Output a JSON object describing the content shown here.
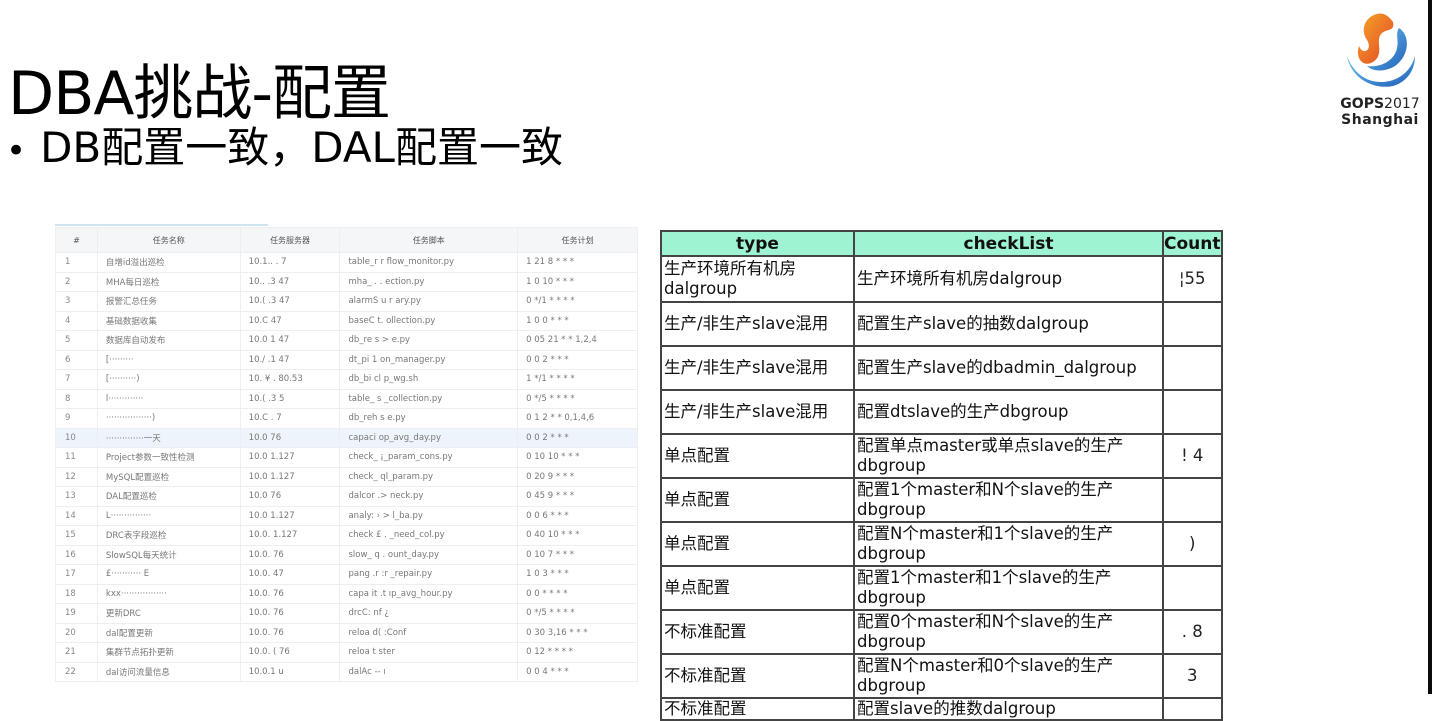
{
  "slide": {
    "title": "DBA挑战-配置",
    "bullet": "DB配置一致，DAL配置一致",
    "bullet_symbol": "•"
  },
  "logo": {
    "icon": "gops-flame-logo-icon",
    "brand": "GOPS",
    "year": "2017",
    "city": "Shanghai",
    "colors": {
      "orange": "#f08a24",
      "red": "#e2452b",
      "blue": "#2c7fd1",
      "light_blue": "#6cc3f0"
    }
  },
  "task_table": {
    "headers": [
      "#",
      "任务名称",
      "任务服务器",
      "任务脚本",
      "任务计划"
    ],
    "highlighted_row": 10,
    "rows": [
      {
        "num": "1",
        "name": "自增id溢出巡检",
        "server": "10.1.. . 7",
        "script": "table_r r flow_monitor.py",
        "schedule": "1 21 8 * * *"
      },
      {
        "num": "2",
        "name": "MHA每日巡检",
        "server": "10.. .3  47",
        "script": "mha_ . . ection.py",
        "schedule": "1 0 10 * * *"
      },
      {
        "num": "3",
        "name": "报警汇总任务",
        "server": "10.( .3  47",
        "script": "alarmS u r ary.py",
        "schedule": "0 */1 * * * *"
      },
      {
        "num": "4",
        "name": "基础数据收集",
        "server": "10.C    47",
        "script": "baseC t. ollection.py",
        "schedule": "1 0 0 * * *"
      },
      {
        "num": "5",
        "name": "数据库自动发布",
        "server": "10.0 1  47",
        "script": "db_re s > e.py",
        "schedule": "0 05 21 * * 1,2,4"
      },
      {
        "num": "6",
        "name": "[·········",
        "server": "10./ .1  47",
        "script": "dt_pi 1  on_manager.py",
        "schedule": "0 0 2 * * *"
      },
      {
        "num": "7",
        "name": "[··········)",
        "server": "10. ¥ .  80.53",
        "script": "db_bi cl  p_wg.sh",
        "schedule": "1 */1 * * * *"
      },
      {
        "num": "8",
        "name": "l·············",
        "server": "10.(   .3 5",
        "script": "table_ s  _collection.py",
        "schedule": "0 */5 * * * *"
      },
      {
        "num": "9",
        "name": "·················)",
        "server": "10.C   . 7",
        "script": "db_reh s  e.py",
        "schedule": "0 1 2 * * 0,1,4,6"
      },
      {
        "num": "10",
        "name": "··············一天",
        "server": "10.0   76",
        "script": "capaci    op_avg_day.py",
        "schedule": "0 0 2 * * *"
      },
      {
        "num": "11",
        "name": "Project参数一致性检测",
        "server": "10.0   1.127",
        "script": "check_   ¡_param_cons.py",
        "schedule": "0 10 10 * * *"
      },
      {
        "num": "12",
        "name": "MySQL配置巡检",
        "server": "10.0   1.127",
        "script": "check_    ql_param.py",
        "schedule": "0 20 9 * * *"
      },
      {
        "num": "13",
        "name": "DAL配置巡检",
        "server": "10.0   76",
        "script": "dalcor  .> neck.py",
        "schedule": "0 45 9 * * *"
      },
      {
        "num": "14",
        "name": "L···············",
        "server": "10.0   1.127",
        "script": "analy: › > l_ba.py",
        "schedule": "0 0 6 * * *"
      },
      {
        "num": "15",
        "name": "DRC表字段巡检",
        "server": "10.0.   1.127",
        "script": "check £ . _need_col.py",
        "schedule": "0 40 10 * * *"
      },
      {
        "num": "16",
        "name": "SlowSQL每天统计",
        "server": "10.0.   76",
        "script": "slow_ q . ount_day.py",
        "schedule": "0 10 7 * * *"
      },
      {
        "num": "17",
        "name": "£··········· E",
        "server": "10.0.   47",
        "script": "pang  .r :r _repair.py",
        "schedule": "1 0 3 * * *"
      },
      {
        "num": "18",
        "name": "kxx·················",
        "server": "10.0.   76",
        "script": "capa it  .t  ıp_avg_hour.py",
        "schedule": "0 0 * * * *"
      },
      {
        "num": "19",
        "name": "更新DRC",
        "server": "10.0.   76",
        "script": "drcC: nf ¿",
        "schedule": "0 */5 * * * *"
      },
      {
        "num": "20",
        "name": "dal配置更新",
        "server": "10.0.   76",
        "script": "reloa d(  :Conf",
        "schedule": "0 30 3,16 * * *"
      },
      {
        "num": "21",
        "name": "集群节点拓扑更新",
        "server": "10.0. ( 76",
        "script": "reloa t   ster",
        "schedule": "0 12 * * * *"
      },
      {
        "num": "22",
        "name": "dal访问流量信息",
        "server": "10.0.1   u",
        "script": "dalAc  -- ı",
        "schedule": "0 0 4 * * *"
      }
    ]
  },
  "check_table": {
    "header_color": "#9ef3d3",
    "headers": {
      "type": "type",
      "checklist": "checkList",
      "count": "Count"
    },
    "rows": [
      {
        "type": "生产环境所有机房dalgroup",
        "checklist": "生产环境所有机房dalgroup",
        "count": "¦55"
      },
      {
        "type": "生产/非生产slave混用",
        "checklist": "配置生产slave的抽数dalgroup",
        "count": ""
      },
      {
        "type": "生产/非生产slave混用",
        "checklist": "配置生产slave的dbadmin_dalgroup",
        "count": ""
      },
      {
        "type": "生产/非生产slave混用",
        "checklist": "配置dtslave的生产dbgroup",
        "count": ""
      },
      {
        "type": "单点配置",
        "checklist": "配置单点master或单点slave的生产dbgroup",
        "count": "! 4"
      },
      {
        "type": "单点配置",
        "checklist": "配置1个master和N个slave的生产dbgroup",
        "count": ""
      },
      {
        "type": "单点配置",
        "checklist": "配置N个master和1个slave的生产dbgroup",
        "count": ")"
      },
      {
        "type": "单点配置",
        "checklist": "配置1个master和1个slave的生产dbgroup",
        "count": ""
      },
      {
        "type": "不标准配置",
        "checklist": "配置0个master和N个slave的生产dbgroup",
        "count": ". 8"
      },
      {
        "type": "不标准配置",
        "checklist": "配置N个master和0个slave的生产dbgroup",
        "count": "3"
      },
      {
        "type": "不标准配置",
        "checklist": "配置slave的推数dalgroup",
        "count": ""
      }
    ]
  }
}
